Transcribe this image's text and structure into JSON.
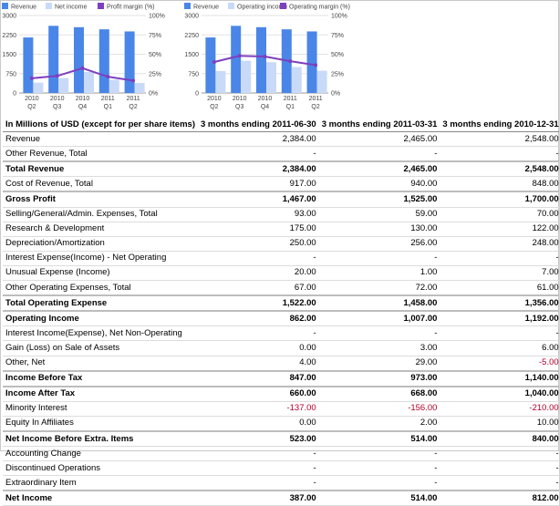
{
  "chart_data": [
    {
      "type": "bar",
      "legend": [
        "Revenue",
        "Net income",
        "Profit margin (%)"
      ],
      "legend_placement": "top",
      "categories": [
        [
          "2010",
          "Q2"
        ],
        [
          "2010",
          "Q3"
        ],
        [
          "2010",
          "Q4"
        ],
        [
          "2011",
          "Q1"
        ],
        [
          "2011",
          "Q2"
        ]
      ],
      "series": [
        {
          "name": "Revenue",
          "kind": "bar",
          "axis": "left",
          "values": [
            2150,
            2600,
            2548,
            2465,
            2384
          ]
        },
        {
          "name": "Net income",
          "kind": "bar",
          "axis": "left",
          "values": [
            400,
            580,
            812,
            514,
            387
          ]
        },
        {
          "name": "Profit margin (%)",
          "kind": "line",
          "axis": "right",
          "values": [
            19,
            22,
            32,
            21,
            16
          ]
        }
      ],
      "ylim_left": [
        0,
        3000
      ],
      "yticks_left": [
        "0",
        "750",
        "1500",
        "2250",
        "3000"
      ],
      "ylim_right": [
        0,
        100
      ],
      "yticks_right": [
        "0%",
        "25%",
        "50%",
        "75%",
        "100%"
      ],
      "colors": {
        "Revenue": "#4a86e8",
        "Net income": "#c9daf8",
        "Profit margin (%)": "#7e3fbf"
      }
    },
    {
      "type": "bar",
      "legend": [
        "Revenue",
        "Operating income",
        "Operating margin (%)"
      ],
      "legend_placement": "top",
      "categories": [
        [
          "2010",
          "Q2"
        ],
        [
          "2010",
          "Q3"
        ],
        [
          "2010",
          "Q4"
        ],
        [
          "2011",
          "Q1"
        ],
        [
          "2011",
          "Q2"
        ]
      ],
      "series": [
        {
          "name": "Revenue",
          "kind": "bar",
          "axis": "left",
          "values": [
            2150,
            2600,
            2548,
            2465,
            2384
          ]
        },
        {
          "name": "Operating income",
          "kind": "bar",
          "axis": "left",
          "values": [
            850,
            1250,
            1192,
            1007,
            862
          ]
        },
        {
          "name": "Operating margin (%)",
          "kind": "line",
          "axis": "right",
          "values": [
            40,
            48,
            47,
            41,
            36
          ]
        }
      ],
      "ylim_left": [
        0,
        3000
      ],
      "yticks_left": [
        "0",
        "750",
        "1500",
        "2250",
        "3000"
      ],
      "ylim_right": [
        0,
        100
      ],
      "yticks_right": [
        "0%",
        "25%",
        "50%",
        "75%",
        "100%"
      ],
      "colors": {
        "Revenue": "#4a86e8",
        "Operating income": "#c9daf8",
        "Operating margin (%)": "#7e3fbf"
      }
    }
  ],
  "table": {
    "headers": [
      "In Millions of USD (except for per share items)",
      "3 months ending 2011-06-30",
      "3 months ending 2011-03-31",
      "3 months ending 2010-12-31"
    ],
    "rows": [
      {
        "label": "Revenue",
        "bold": false,
        "values": [
          "2,384.00",
          "2,465.00",
          "2,548.00"
        ]
      },
      {
        "label": "Other Revenue, Total",
        "bold": false,
        "values": [
          "-",
          "-",
          "-"
        ]
      },
      {
        "label": "Total Revenue",
        "bold": true,
        "values": [
          "2,384.00",
          "2,465.00",
          "2,548.00"
        ]
      },
      {
        "label": "Cost of Revenue, Total",
        "bold": false,
        "values": [
          "917.00",
          "940.00",
          "848.00"
        ]
      },
      {
        "label": "Gross Profit",
        "bold": true,
        "values": [
          "1,467.00",
          "1,525.00",
          "1,700.00"
        ]
      },
      {
        "label": "Selling/General/Admin. Expenses, Total",
        "bold": false,
        "values": [
          "93.00",
          "59.00",
          "70.00"
        ]
      },
      {
        "label": "Research & Development",
        "bold": false,
        "values": [
          "175.00",
          "130.00",
          "122.00"
        ]
      },
      {
        "label": "Depreciation/Amortization",
        "bold": false,
        "values": [
          "250.00",
          "256.00",
          "248.00"
        ]
      },
      {
        "label": "Interest Expense(Income) - Net Operating",
        "bold": false,
        "values": [
          "-",
          "-",
          "-"
        ]
      },
      {
        "label": "Unusual Expense (Income)",
        "bold": false,
        "values": [
          "20.00",
          "1.00",
          "7.00"
        ]
      },
      {
        "label": "Other Operating Expenses, Total",
        "bold": false,
        "values": [
          "67.00",
          "72.00",
          "61.00"
        ]
      },
      {
        "label": "Total Operating Expense",
        "bold": true,
        "values": [
          "1,522.00",
          "1,458.00",
          "1,356.00"
        ]
      },
      {
        "label": "Operating Income",
        "bold": true,
        "values": [
          "862.00",
          "1,007.00",
          "1,192.00"
        ]
      },
      {
        "label": "Interest Income(Expense), Net Non-Operating",
        "bold": false,
        "values": [
          "-",
          "-",
          "-"
        ]
      },
      {
        "label": "Gain (Loss) on Sale of Assets",
        "bold": false,
        "values": [
          "0.00",
          "3.00",
          "6.00"
        ]
      },
      {
        "label": "Other, Net",
        "bold": false,
        "values": [
          "4.00",
          "29.00",
          "-5.00"
        ]
      },
      {
        "label": "Income Before Tax",
        "bold": true,
        "values": [
          "847.00",
          "973.00",
          "1,140.00"
        ]
      },
      {
        "label": "Income After Tax",
        "bold": true,
        "values": [
          "660.00",
          "668.00",
          "1,040.00"
        ]
      },
      {
        "label": "Minority Interest",
        "bold": false,
        "values": [
          "-137.00",
          "-156.00",
          "-210.00"
        ]
      },
      {
        "label": "Equity In Affiliates",
        "bold": false,
        "values": [
          "0.00",
          "2.00",
          "10.00"
        ]
      },
      {
        "label": "Net Income Before Extra. Items",
        "bold": true,
        "values": [
          "523.00",
          "514.00",
          "840.00"
        ]
      },
      {
        "label": "Accounting Change",
        "bold": false,
        "values": [
          "-",
          "-",
          "-"
        ]
      },
      {
        "label": "Discontinued Operations",
        "bold": false,
        "values": [
          "-",
          "-",
          "-"
        ]
      },
      {
        "label": "Extraordinary Item",
        "bold": false,
        "values": [
          "-",
          "-",
          "-"
        ]
      },
      {
        "label": "Net Income",
        "bold": true,
        "values": [
          "387.00",
          "514.00",
          "812.00"
        ]
      }
    ]
  }
}
